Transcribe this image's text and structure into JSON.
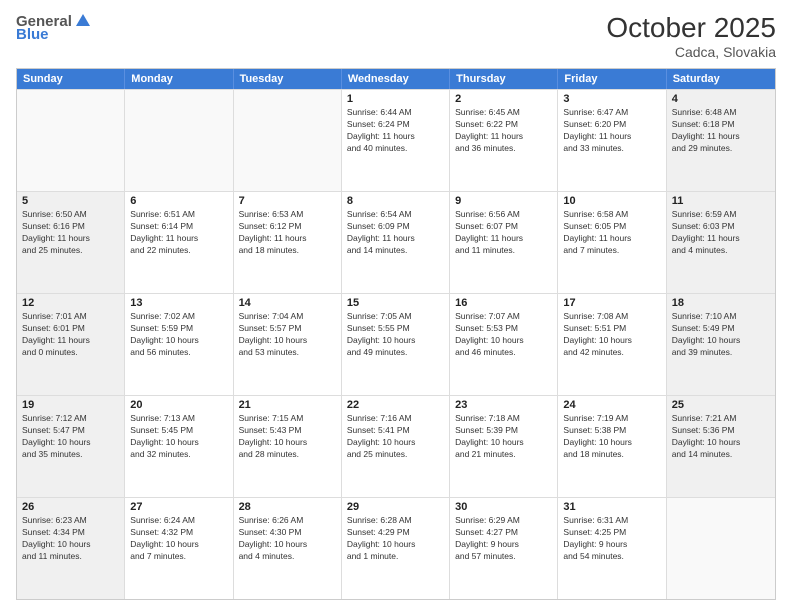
{
  "header": {
    "logo_general": "General",
    "logo_blue": "Blue",
    "month_title": "October 2025",
    "location": "Cadca, Slovakia"
  },
  "days_of_week": [
    "Sunday",
    "Monday",
    "Tuesday",
    "Wednesday",
    "Thursday",
    "Friday",
    "Saturday"
  ],
  "rows": [
    [
      {
        "day": "",
        "empty": true
      },
      {
        "day": "",
        "empty": true
      },
      {
        "day": "",
        "empty": true
      },
      {
        "day": "1",
        "lines": [
          "Sunrise: 6:44 AM",
          "Sunset: 6:24 PM",
          "Daylight: 11 hours",
          "and 40 minutes."
        ]
      },
      {
        "day": "2",
        "lines": [
          "Sunrise: 6:45 AM",
          "Sunset: 6:22 PM",
          "Daylight: 11 hours",
          "and 36 minutes."
        ]
      },
      {
        "day": "3",
        "lines": [
          "Sunrise: 6:47 AM",
          "Sunset: 6:20 PM",
          "Daylight: 11 hours",
          "and 33 minutes."
        ]
      },
      {
        "day": "4",
        "shaded": true,
        "lines": [
          "Sunrise: 6:48 AM",
          "Sunset: 6:18 PM",
          "Daylight: 11 hours",
          "and 29 minutes."
        ]
      }
    ],
    [
      {
        "day": "5",
        "shaded": true,
        "lines": [
          "Sunrise: 6:50 AM",
          "Sunset: 6:16 PM",
          "Daylight: 11 hours",
          "and 25 minutes."
        ]
      },
      {
        "day": "6",
        "lines": [
          "Sunrise: 6:51 AM",
          "Sunset: 6:14 PM",
          "Daylight: 11 hours",
          "and 22 minutes."
        ]
      },
      {
        "day": "7",
        "lines": [
          "Sunrise: 6:53 AM",
          "Sunset: 6:12 PM",
          "Daylight: 11 hours",
          "and 18 minutes."
        ]
      },
      {
        "day": "8",
        "lines": [
          "Sunrise: 6:54 AM",
          "Sunset: 6:09 PM",
          "Daylight: 11 hours",
          "and 14 minutes."
        ]
      },
      {
        "day": "9",
        "lines": [
          "Sunrise: 6:56 AM",
          "Sunset: 6:07 PM",
          "Daylight: 11 hours",
          "and 11 minutes."
        ]
      },
      {
        "day": "10",
        "lines": [
          "Sunrise: 6:58 AM",
          "Sunset: 6:05 PM",
          "Daylight: 11 hours",
          "and 7 minutes."
        ]
      },
      {
        "day": "11",
        "shaded": true,
        "lines": [
          "Sunrise: 6:59 AM",
          "Sunset: 6:03 PM",
          "Daylight: 11 hours",
          "and 4 minutes."
        ]
      }
    ],
    [
      {
        "day": "12",
        "shaded": true,
        "lines": [
          "Sunrise: 7:01 AM",
          "Sunset: 6:01 PM",
          "Daylight: 11 hours",
          "and 0 minutes."
        ]
      },
      {
        "day": "13",
        "lines": [
          "Sunrise: 7:02 AM",
          "Sunset: 5:59 PM",
          "Daylight: 10 hours",
          "and 56 minutes."
        ]
      },
      {
        "day": "14",
        "lines": [
          "Sunrise: 7:04 AM",
          "Sunset: 5:57 PM",
          "Daylight: 10 hours",
          "and 53 minutes."
        ]
      },
      {
        "day": "15",
        "lines": [
          "Sunrise: 7:05 AM",
          "Sunset: 5:55 PM",
          "Daylight: 10 hours",
          "and 49 minutes."
        ]
      },
      {
        "day": "16",
        "lines": [
          "Sunrise: 7:07 AM",
          "Sunset: 5:53 PM",
          "Daylight: 10 hours",
          "and 46 minutes."
        ]
      },
      {
        "day": "17",
        "lines": [
          "Sunrise: 7:08 AM",
          "Sunset: 5:51 PM",
          "Daylight: 10 hours",
          "and 42 minutes."
        ]
      },
      {
        "day": "18",
        "shaded": true,
        "lines": [
          "Sunrise: 7:10 AM",
          "Sunset: 5:49 PM",
          "Daylight: 10 hours",
          "and 39 minutes."
        ]
      }
    ],
    [
      {
        "day": "19",
        "shaded": true,
        "lines": [
          "Sunrise: 7:12 AM",
          "Sunset: 5:47 PM",
          "Daylight: 10 hours",
          "and 35 minutes."
        ]
      },
      {
        "day": "20",
        "lines": [
          "Sunrise: 7:13 AM",
          "Sunset: 5:45 PM",
          "Daylight: 10 hours",
          "and 32 minutes."
        ]
      },
      {
        "day": "21",
        "lines": [
          "Sunrise: 7:15 AM",
          "Sunset: 5:43 PM",
          "Daylight: 10 hours",
          "and 28 minutes."
        ]
      },
      {
        "day": "22",
        "lines": [
          "Sunrise: 7:16 AM",
          "Sunset: 5:41 PM",
          "Daylight: 10 hours",
          "and 25 minutes."
        ]
      },
      {
        "day": "23",
        "lines": [
          "Sunrise: 7:18 AM",
          "Sunset: 5:39 PM",
          "Daylight: 10 hours",
          "and 21 minutes."
        ]
      },
      {
        "day": "24",
        "lines": [
          "Sunrise: 7:19 AM",
          "Sunset: 5:38 PM",
          "Daylight: 10 hours",
          "and 18 minutes."
        ]
      },
      {
        "day": "25",
        "shaded": true,
        "lines": [
          "Sunrise: 7:21 AM",
          "Sunset: 5:36 PM",
          "Daylight: 10 hours",
          "and 14 minutes."
        ]
      }
    ],
    [
      {
        "day": "26",
        "shaded": true,
        "lines": [
          "Sunrise: 6:23 AM",
          "Sunset: 4:34 PM",
          "Daylight: 10 hours",
          "and 11 minutes."
        ]
      },
      {
        "day": "27",
        "lines": [
          "Sunrise: 6:24 AM",
          "Sunset: 4:32 PM",
          "Daylight: 10 hours",
          "and 7 minutes."
        ]
      },
      {
        "day": "28",
        "lines": [
          "Sunrise: 6:26 AM",
          "Sunset: 4:30 PM",
          "Daylight: 10 hours",
          "and 4 minutes."
        ]
      },
      {
        "day": "29",
        "lines": [
          "Sunrise: 6:28 AM",
          "Sunset: 4:29 PM",
          "Daylight: 10 hours",
          "and 1 minute."
        ]
      },
      {
        "day": "30",
        "lines": [
          "Sunrise: 6:29 AM",
          "Sunset: 4:27 PM",
          "Daylight: 9 hours",
          "and 57 minutes."
        ]
      },
      {
        "day": "31",
        "lines": [
          "Sunrise: 6:31 AM",
          "Sunset: 4:25 PM",
          "Daylight: 9 hours",
          "and 54 minutes."
        ]
      },
      {
        "day": "",
        "empty": true
      }
    ]
  ]
}
